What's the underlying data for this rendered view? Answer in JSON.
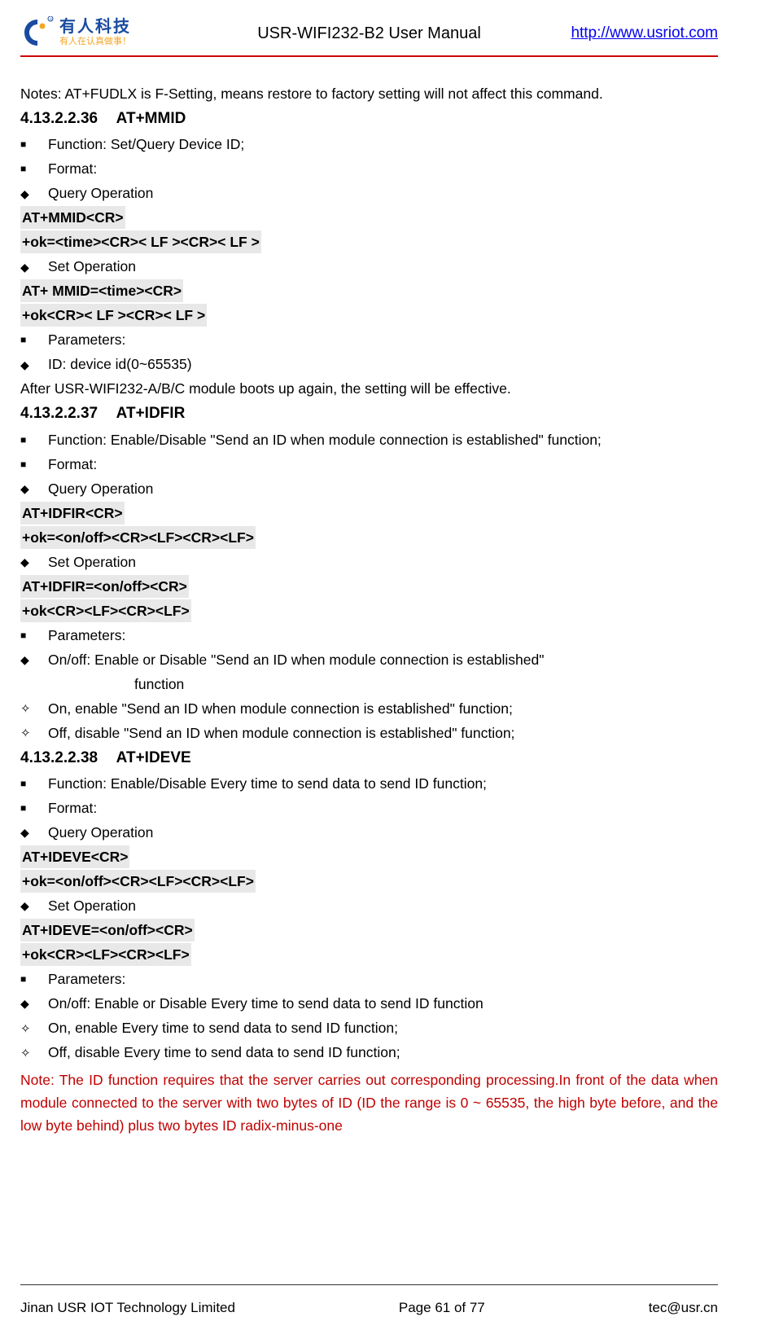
{
  "header": {
    "logo_cn": "有人科技",
    "logo_sub": "有人在认真做事！",
    "title": "USR-WIFI232-B2 User Manual",
    "link": "http://www.usriot.com"
  },
  "intro_note": "Notes: AT+FUDLX is F-Setting, means restore to factory setting will not affect this command.",
  "s36": {
    "num": "4.13.2.2.36",
    "title": "AT+MMID",
    "func": "Function: Set/Query Device ID;",
    "format": "Format:",
    "query_op": "Query Operation",
    "cmd1": "AT+MMID<CR>",
    "cmd2": "+ok=<time><CR>< LF ><CR>< LF >",
    "set_op": "Set Operation",
    "cmd3": "AT+ MMID=<time><CR>",
    "cmd4": "+ok<CR>< LF ><CR>< LF >",
    "params": "Parameters:",
    "p1": "ID: device id(0~65535)",
    "after": "After USR-WIFI232-A/B/C module boots up again, the setting will be effective."
  },
  "s37": {
    "num": "4.13.2.2.37",
    "title": "AT+IDFIR",
    "func": "Function: Enable/Disable \"Send an ID when module connection is established\" function;",
    "format": "Format:",
    "query_op": "Query Operation",
    "cmd1": "AT+IDFIR<CR>",
    "cmd2": "+ok=<on/off><CR><LF><CR><LF>",
    "set_op": "Set Operation",
    "cmd3": "AT+IDFIR=<on/off><CR>",
    "cmd4": "+ok<CR><LF><CR><LF>",
    "params": "Parameters:",
    "p1a": "On/off:  Enable  or  Disable  \"Send  an  ID  when  module  connection  is  established\"",
    "p1b": "function",
    "p2": "On, enable \"Send an ID when module connection is established\" function;",
    "p3": "Off, disable \"Send an ID when module connection is established\" function;"
  },
  "s38": {
    "num": "4.13.2.2.38",
    "title": "AT+IDEVE",
    "func": "Function: Enable/Disable Every time to send data to send ID function;",
    "format": "Format:",
    "query_op": "Query Operation",
    "cmd1": "AT+IDEVE<CR>",
    "cmd2": "+ok=<on/off><CR><LF><CR><LF>",
    "set_op": "Set Operation",
    "cmd3": "AT+IDEVE=<on/off><CR>",
    "cmd4": "+ok<CR><LF><CR><LF>",
    "params": "Parameters:",
    "p1": "On/off: Enable or Disable Every time to send data to send ID function",
    "p2": "On, enable Every time to send data to send ID function;",
    "p3": "Off, disable Every time to send data to send ID function;"
  },
  "red_note": "Note: The ID function requires that the server carries out corresponding processing.In front of the data when module connected to the server with two bytes of ID (ID the range is 0 ~ 65535, the high   byte   before,   and   the   low   byte   behind)   plus   two   bytes   ID   radix-minus-one",
  "footer": {
    "company": "Jinan USR IOT Technology Limited",
    "page": "Page 61 of 77",
    "email": "tec@usr.cn"
  }
}
